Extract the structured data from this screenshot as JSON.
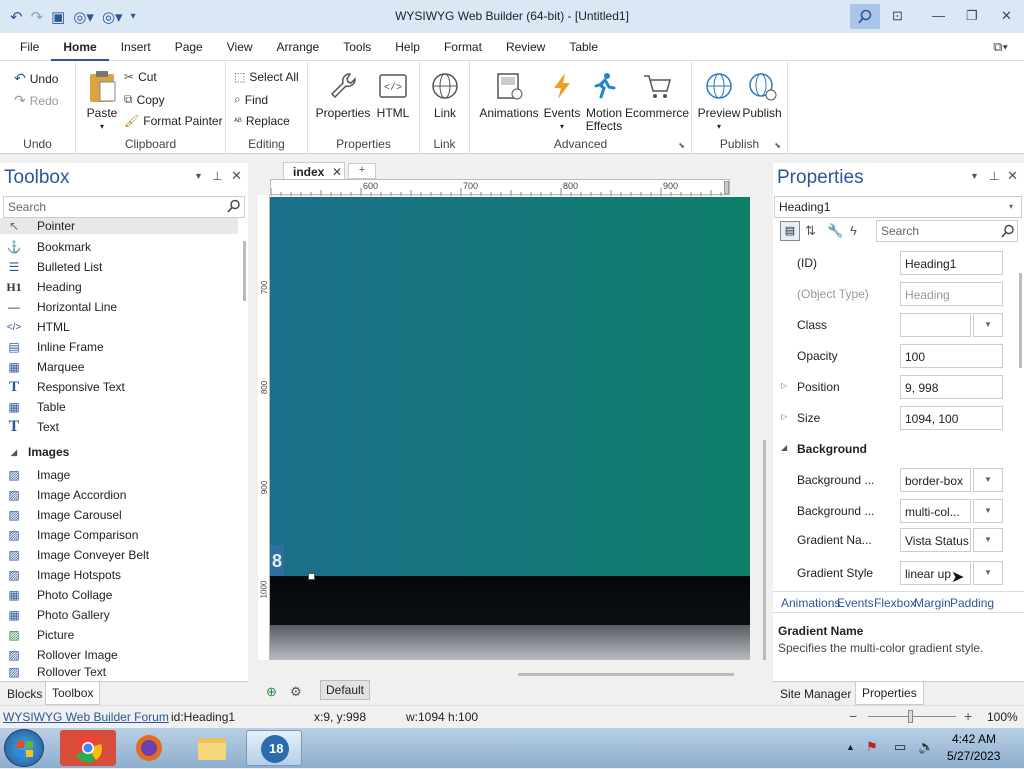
{
  "window": {
    "title": "WYSIWYG Web Builder (64-bit) - [Untitled1]"
  },
  "menu": [
    "File",
    "Home",
    "Insert",
    "Page",
    "View",
    "Arrange",
    "Tools",
    "Help",
    "Format",
    "Review",
    "Table"
  ],
  "ribbon": {
    "undo": "Undo",
    "redo": "Redo",
    "undo_group": "Undo",
    "paste": "Paste",
    "cut": "Cut",
    "copy": "Copy",
    "format_painter": "Format Painter",
    "clipboard_group": "Clipboard",
    "select_all": "Select All",
    "find": "Find",
    "replace": "Replace",
    "editing_group": "Editing",
    "properties": "Properties",
    "html": "HTML",
    "properties_group": "Properties",
    "link": "Link",
    "link_group": "Link",
    "animations": "Animations",
    "events": "Events",
    "motion_effects_1": "Motion",
    "motion_effects_2": "Effects",
    "ecommerce": "Ecommerce",
    "advanced_group": "Advanced",
    "preview": "Preview",
    "publish": "Publish",
    "publish_group": "Publish"
  },
  "toolbox": {
    "title": "Toolbox",
    "search_placeholder": "Search",
    "items": [
      "Pointer",
      "Bookmark",
      "Bulleted List",
      "Heading",
      "Horizontal Line",
      "HTML",
      "Inline Frame",
      "Marquee",
      "Responsive Text",
      "Table",
      "Text"
    ],
    "images_header": "Images",
    "image_items": [
      "Image",
      "Image Accordion",
      "Image Carousel",
      "Image Comparison",
      "Image Conveyer Belt",
      "Image Hotspots",
      "Photo Collage",
      "Photo Gallery",
      "Picture",
      "Rollover Image",
      "Rollover Text"
    ],
    "tabs": [
      "Blocks",
      "Toolbox"
    ]
  },
  "editor": {
    "tab": "index",
    "ruler_h": [
      "600",
      "700",
      "800",
      "900"
    ],
    "ruler_v": [
      "700",
      "800",
      "900",
      "1000"
    ],
    "canvas_glyph": "8",
    "bottom_default": "Default"
  },
  "properties": {
    "title": "Properties",
    "object": "Heading1",
    "search_placeholder": "Search",
    "rows": [
      {
        "label": "(ID)",
        "value": "Heading1"
      },
      {
        "label": "(Object Type)",
        "value": "Heading"
      },
      {
        "label": "Class",
        "value": ""
      },
      {
        "label": "Opacity",
        "value": "100"
      },
      {
        "label": "Position",
        "value": "9, 998"
      },
      {
        "label": "Size",
        "value": "1094, 100"
      }
    ],
    "section": "Background",
    "bg_rows": [
      {
        "label": "Background ...",
        "value": "border-box"
      },
      {
        "label": "Background ...",
        "value": "multi-col..."
      },
      {
        "label": "Gradient Na...",
        "value": "Vista Status"
      },
      {
        "label": "Gradient Style",
        "value": "linear up"
      }
    ],
    "links": [
      "Animations",
      "Events",
      "Flexbox",
      "Margin",
      "Padding"
    ],
    "desc_title": "Gradient Name",
    "desc_text": "Specifies the multi-color gradient style.",
    "tabs": [
      "Site Manager",
      "Properties"
    ]
  },
  "status": {
    "forum": "WYSIWYG Web Builder Forum",
    "id": "id:Heading1",
    "xy": "x:9, y:998",
    "wh": "w:1094 h:100",
    "zoom": "100%"
  },
  "taskbar": {
    "time": "4:42 AM",
    "date": "5/27/2023",
    "app_badge": "18"
  }
}
